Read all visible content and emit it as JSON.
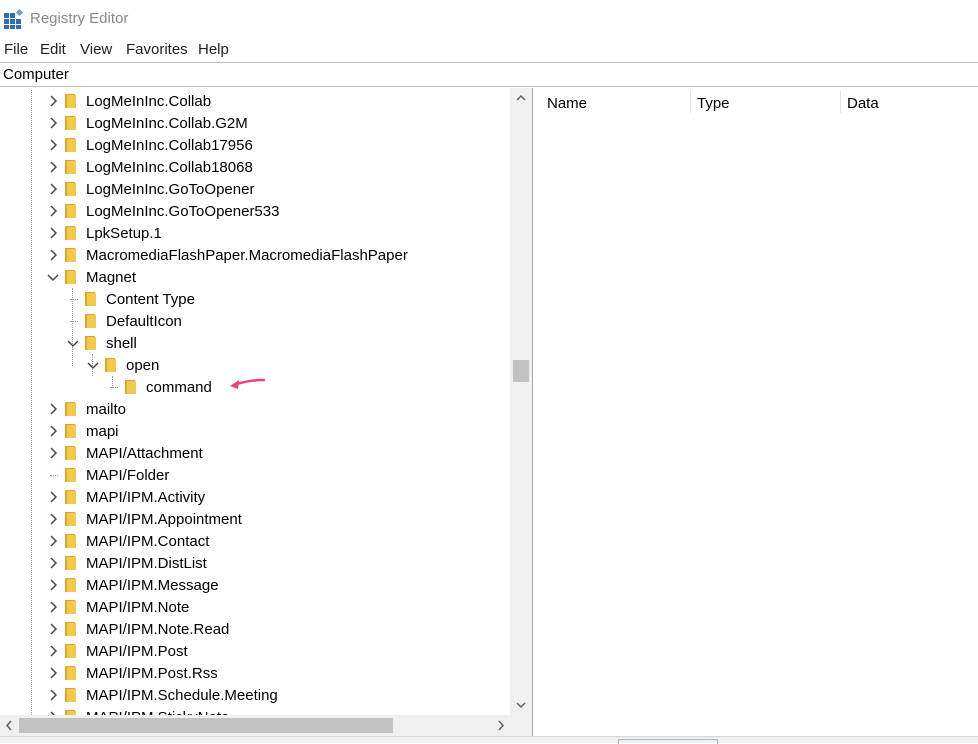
{
  "window": {
    "title": "Registry Editor"
  },
  "menu": [
    "File",
    "Edit",
    "View",
    "Favorites",
    "Help"
  ],
  "address": {
    "value": "Computer"
  },
  "columns": [
    "Name",
    "Type",
    "Data"
  ],
  "colors": {
    "folder": "#f3c94d",
    "folder_dark": "#e0a828",
    "arrow": "#e8457a",
    "app_icon": "#2a6fb7"
  },
  "tree": [
    {
      "label": "LogMeInInc.Collab",
      "level": 0,
      "state": "collapsed"
    },
    {
      "label": "LogMeInInc.Collab.G2M",
      "level": 0,
      "state": "collapsed"
    },
    {
      "label": "LogMeInInc.Collab17956",
      "level": 0,
      "state": "collapsed"
    },
    {
      "label": "LogMeInInc.Collab18068",
      "level": 0,
      "state": "collapsed"
    },
    {
      "label": "LogMeInInc.GoToOpener",
      "level": 0,
      "state": "collapsed"
    },
    {
      "label": "LogMeInInc.GoToOpener533",
      "level": 0,
      "state": "collapsed"
    },
    {
      "label": "LpkSetup.1",
      "level": 0,
      "state": "collapsed"
    },
    {
      "label": "MacromediaFlashPaper.MacromediaFlashPaper",
      "level": 0,
      "state": "collapsed"
    },
    {
      "label": "Magnet",
      "level": 0,
      "state": "expanded"
    },
    {
      "label": "Content Type",
      "level": 1,
      "state": "leaf"
    },
    {
      "label": "DefaultIcon",
      "level": 1,
      "state": "leaf"
    },
    {
      "label": "shell",
      "level": 1,
      "state": "expanded"
    },
    {
      "label": "open",
      "level": 2,
      "state": "expanded"
    },
    {
      "label": "command",
      "level": 3,
      "state": "leaf"
    },
    {
      "label": "mailto",
      "level": 0,
      "state": "collapsed"
    },
    {
      "label": "mapi",
      "level": 0,
      "state": "collapsed"
    },
    {
      "label": "MAPI/Attachment",
      "level": 0,
      "state": "collapsed"
    },
    {
      "label": "MAPI/Folder",
      "level": 0,
      "state": "leaf"
    },
    {
      "label": "MAPI/IPM.Activity",
      "level": 0,
      "state": "collapsed"
    },
    {
      "label": "MAPI/IPM.Appointment",
      "level": 0,
      "state": "collapsed"
    },
    {
      "label": "MAPI/IPM.Contact",
      "level": 0,
      "state": "collapsed"
    },
    {
      "label": "MAPI/IPM.DistList",
      "level": 0,
      "state": "collapsed"
    },
    {
      "label": "MAPI/IPM.Message",
      "level": 0,
      "state": "collapsed"
    },
    {
      "label": "MAPI/IPM.Note",
      "level": 0,
      "state": "collapsed"
    },
    {
      "label": "MAPI/IPM.Note.Read",
      "level": 0,
      "state": "collapsed"
    },
    {
      "label": "MAPI/IPM.Post",
      "level": 0,
      "state": "collapsed"
    },
    {
      "label": "MAPI/IPM.Post.Rss",
      "level": 0,
      "state": "collapsed"
    },
    {
      "label": "MAPI/IPM.Schedule.Meeting",
      "level": 0,
      "state": "collapsed"
    },
    {
      "label": "MAPI/IPM.StickyNote",
      "level": 0,
      "state": "collapsed"
    }
  ]
}
